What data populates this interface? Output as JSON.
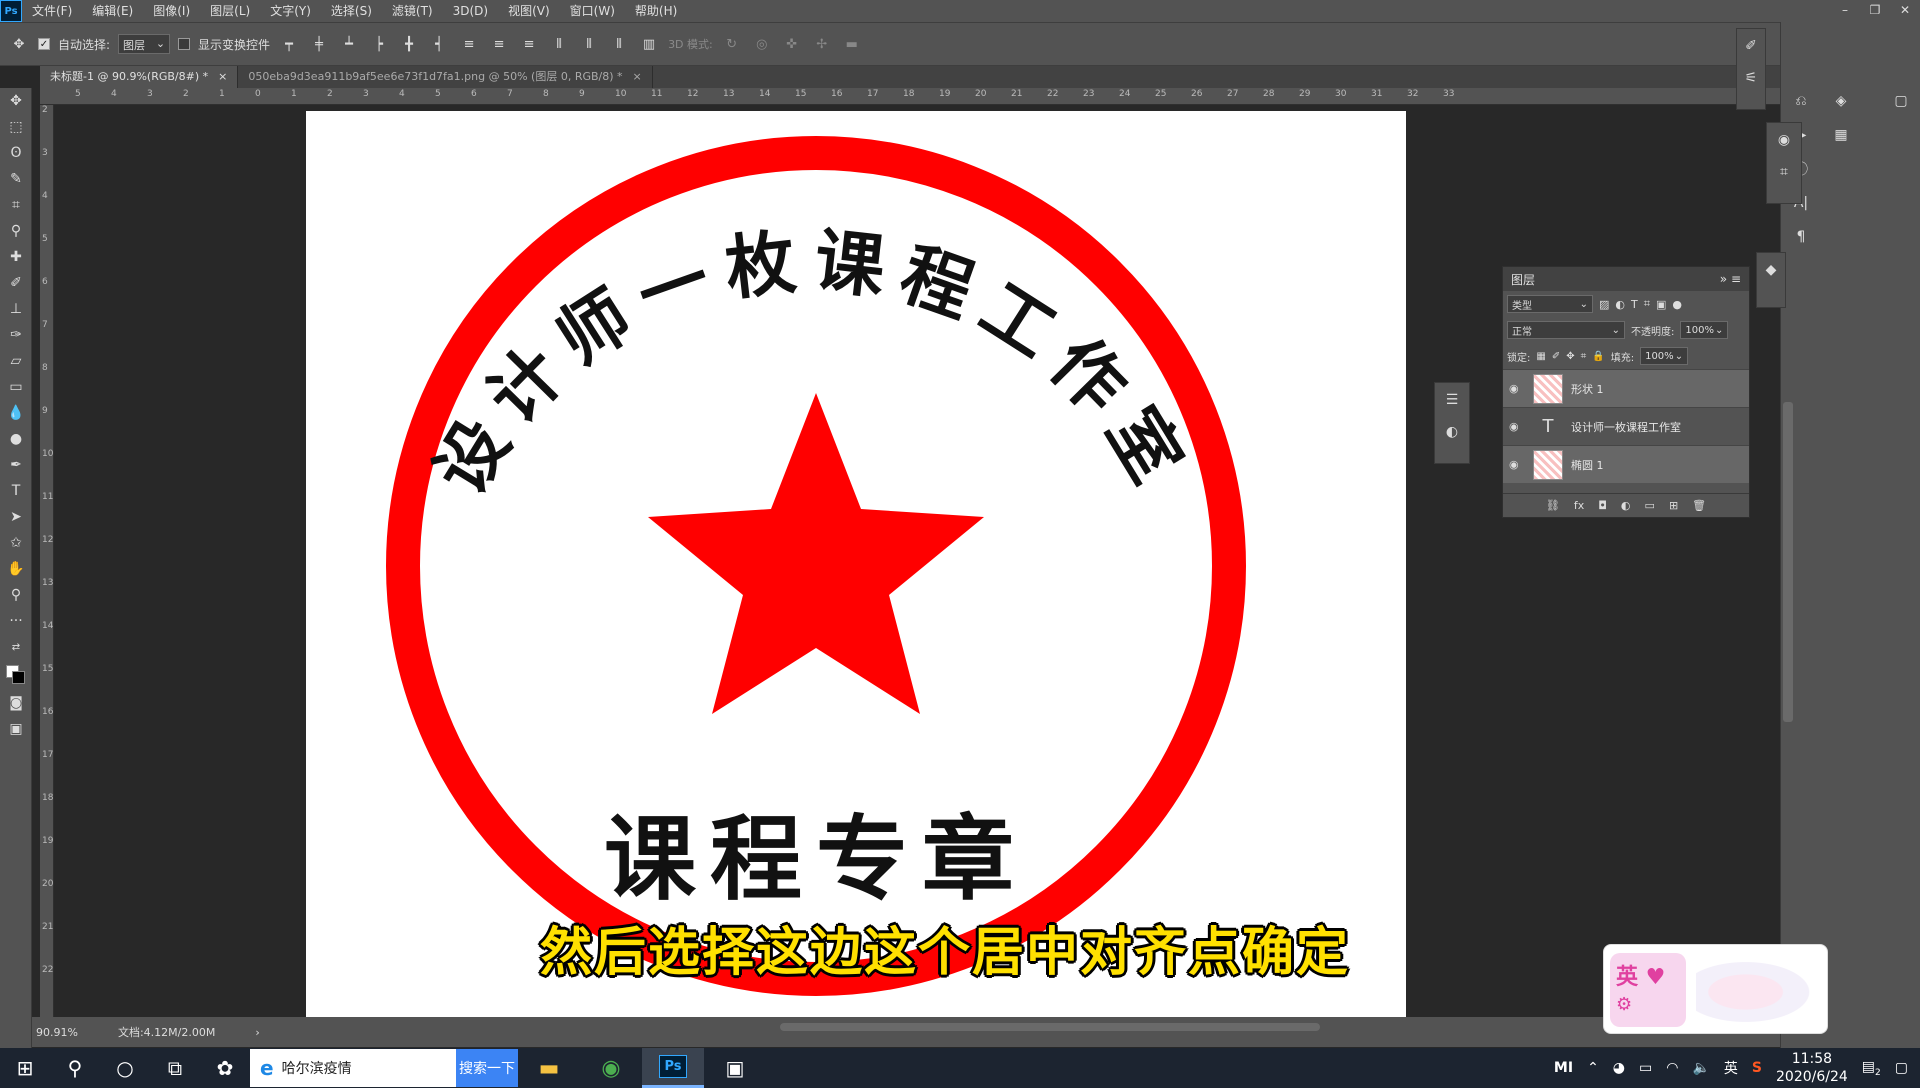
{
  "menubar": {
    "logo": "Ps",
    "items": [
      "文件(F)",
      "编辑(E)",
      "图像(I)",
      "图层(L)",
      "文字(Y)",
      "选择(S)",
      "滤镜(T)",
      "3D(D)",
      "视图(V)",
      "窗口(W)",
      "帮助(H)"
    ],
    "window_controls": [
      "–",
      "❐",
      "✕"
    ]
  },
  "options": {
    "auto_select_label": "自动选择:",
    "auto_select_checked": true,
    "target_value": "图层",
    "show_transform_label": "显示变换控件",
    "show_transform_checked": false,
    "mode_3d_label": "3D 模式:"
  },
  "tabs": [
    {
      "label": "未标题-1 @ 90.9%(RGB/8#) *",
      "active": true
    },
    {
      "label": "050eba9d3ea911b9af5ee6e73f1d7fa1.png @ 50% (图层 0, RGB/8) *",
      "active": false
    }
  ],
  "ruler_h": [
    "5",
    "4",
    "3",
    "2",
    "1",
    "0",
    "1",
    "2",
    "3",
    "4",
    "5",
    "6",
    "7",
    "8",
    "9",
    "10",
    "11",
    "12",
    "13",
    "14",
    "15",
    "16",
    "17",
    "18",
    "19",
    "20",
    "21",
    "22",
    "23",
    "24",
    "25",
    "26",
    "27",
    "28",
    "29",
    "30",
    "31",
    "32",
    "33"
  ],
  "ruler_v": [
    "2",
    "3",
    "4",
    "5",
    "6",
    "7",
    "8",
    "9",
    "10",
    "11",
    "12",
    "13",
    "14",
    "15",
    "16",
    "17",
    "18",
    "19",
    "20",
    "21",
    "22"
  ],
  "stamp": {
    "arc_text": "设计师一枚课程工作室",
    "bottom_text": "课程专章",
    "color": "#ff0000"
  },
  "status": {
    "zoom": "90.91%",
    "doc_size": "文档:4.12M/2.00M"
  },
  "layers_panel": {
    "title": "图层",
    "filter_label": "类型",
    "blend_mode": "正常",
    "opacity_label": "不透明度:",
    "opacity_value": "100%",
    "lock_label": "锁定:",
    "fill_label": "填充:",
    "fill_value": "100%",
    "layers": [
      {
        "name": "形状 1",
        "kind": "shape"
      },
      {
        "name": "设计师一枚课程工作室",
        "kind": "text"
      },
      {
        "name": "椭圆 1",
        "kind": "shape"
      }
    ]
  },
  "subtitle": "然后选择这边这个居中对齐点确定",
  "ime": {
    "lang": "英"
  },
  "taskbar": {
    "search_text": "哈尔滨疫情",
    "search_button": "搜索一下",
    "tray_lang": "英",
    "time": "11:58",
    "date": "2020/6/24",
    "notification_count": "2"
  }
}
